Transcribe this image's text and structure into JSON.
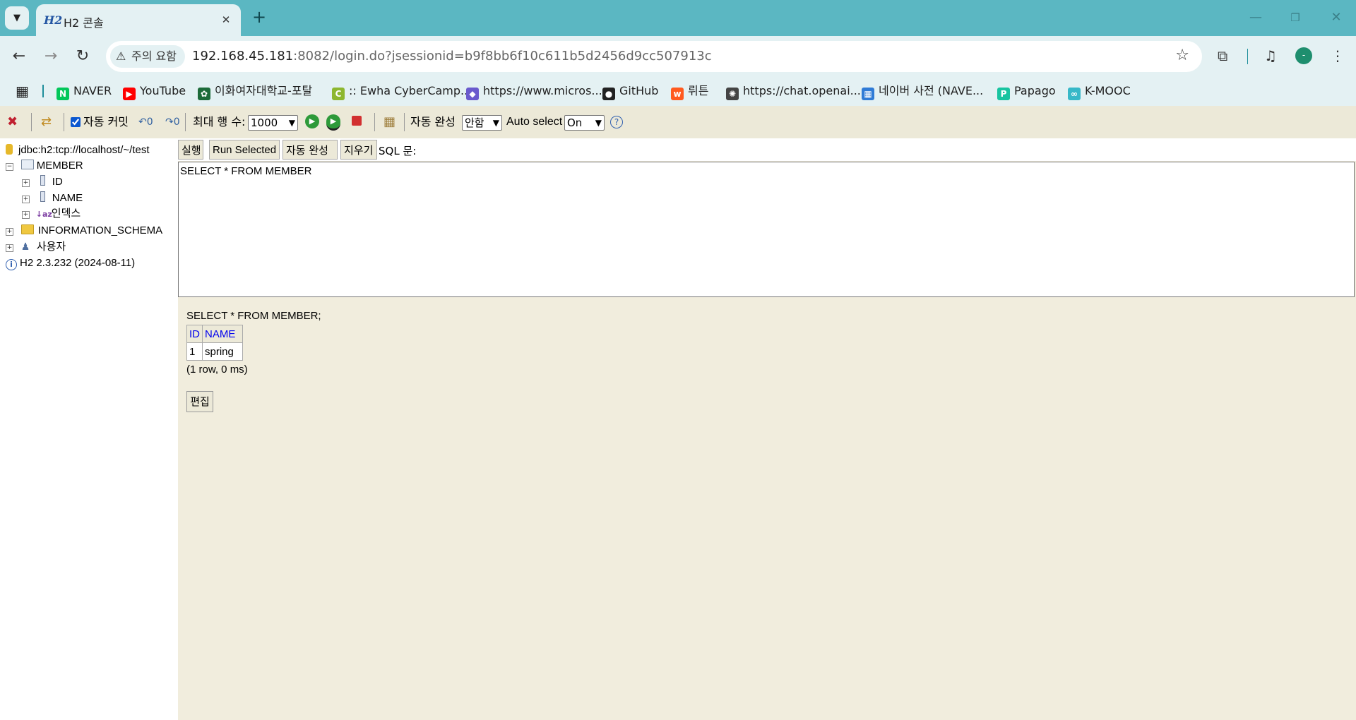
{
  "browser": {
    "tab_title": "H2 콘솔",
    "tab_favicon": "H2",
    "warning_label": "주의 요함",
    "url_host": "192.168.45.181",
    "url_rest": ":8082/login.do?jsessionid=b9f8bb6f10c611b5d2456d9cc507913c",
    "profile_initial": "-"
  },
  "bookmarks": [
    {
      "label": "NAVER",
      "icon": "naver-icon",
      "color": "#03c75a",
      "glyph": "N"
    },
    {
      "label": "YouTube",
      "icon": "youtube-icon",
      "color": "#ff0000",
      "glyph": "▶"
    },
    {
      "label": "이화여자대학교-포탈",
      "icon": "ewha-icon",
      "color": "#1d6b3a",
      "glyph": "✿"
    },
    {
      "label": ":: Ewha CyberCamp...",
      "icon": "cybercampus-icon",
      "color": "#8db72f",
      "glyph": "C"
    },
    {
      "label": "https://www.micros...",
      "icon": "microsoft-icon",
      "color": "#6a5acd",
      "glyph": "◆"
    },
    {
      "label": "GitHub",
      "icon": "github-icon",
      "color": "#222222",
      "glyph": "●"
    },
    {
      "label": "뤼튼",
      "icon": "wrtn-icon",
      "color": "#ff5a1f",
      "glyph": "w"
    },
    {
      "label": "https://chat.openai....",
      "icon": "openai-icon",
      "color": "#444444",
      "glyph": "✺"
    },
    {
      "label": "네이버 사전 (NAVE...",
      "icon": "naver-dict-icon",
      "color": "#2f7bd6",
      "glyph": "▦"
    },
    {
      "label": "Papago",
      "icon": "papago-icon",
      "color": "#18c4a0",
      "glyph": "P"
    },
    {
      "label": "K-MOOC",
      "icon": "kmooc-icon",
      "color": "#37b8c8",
      "glyph": "∞"
    }
  ],
  "h2_toolbar": {
    "autocommit_label": "자동 커밋",
    "autocommit_checked": true,
    "max_rows_label": "최대 행 수:",
    "max_rows_value": "1000",
    "autocomplete_label": "자동 완성",
    "autocomplete_value": "안함",
    "auto_select_label": "Auto select",
    "auto_select_value": "On",
    "help_glyph": "?"
  },
  "tree": {
    "connection": "jdbc:h2:tcp://localhost/~/test",
    "table": "MEMBER",
    "columns": [
      "ID",
      "NAME"
    ],
    "indexes": "인덱스",
    "schema": "INFORMATION_SCHEMA",
    "users": "사용자",
    "version": "H2 2.3.232 (2024-08-11)"
  },
  "sql": {
    "run_label": "실행",
    "run_selected_label": "Run Selected",
    "autocomplete_label": "자동 완성",
    "clear_label": "지우기",
    "sql_label": "SQL 문:",
    "statement": "SELECT * FROM MEMBER"
  },
  "result": {
    "query": "SELECT * FROM MEMBER;",
    "headers": [
      "ID",
      "NAME"
    ],
    "rows": [
      [
        "1",
        "spring"
      ]
    ],
    "summary": "(1 row, 0 ms)",
    "edit_label": "편집"
  }
}
